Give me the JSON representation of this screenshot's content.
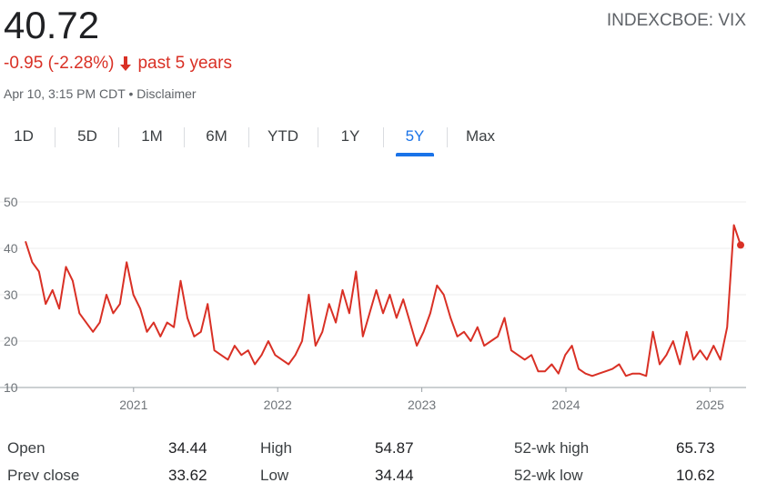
{
  "quote": {
    "price": "40.72",
    "ticker": "INDEXCBOE: VIX",
    "change": "-0.95 (-2.28%)",
    "period": "past 5 years",
    "meta": "Apr 10, 3:15 PM CDT • Disclaimer",
    "accent_color": "#d93025",
    "change_icon": "down-arrow-icon"
  },
  "tabs": [
    {
      "label": "1D"
    },
    {
      "label": "5D"
    },
    {
      "label": "1M"
    },
    {
      "label": "6M"
    },
    {
      "label": "YTD"
    },
    {
      "label": "1Y"
    },
    {
      "label": "5Y"
    },
    {
      "label": "Max"
    }
  ],
  "active_tab": "5Y",
  "chart_data": {
    "type": "line",
    "title": "",
    "xlabel": "",
    "ylabel": "",
    "ylim": [
      10,
      50
    ],
    "yticks": [
      "10",
      "20",
      "30",
      "40",
      "50"
    ],
    "xticks": [
      "2021",
      "2022",
      "2023",
      "2024",
      "2025"
    ],
    "grid": true,
    "line_color": "#d93025",
    "series": [
      {
        "x": [
          "2020-04",
          "2020-04",
          "2020-05",
          "2020-05",
          "2020-05",
          "2020-06",
          "2020-06",
          "2020-06",
          "2020-07",
          "2020-07",
          "2020-08",
          "2020-08",
          "2020-09",
          "2020-09",
          "2020-10",
          "2020-10",
          "2020-10",
          "2020-11",
          "2020-11",
          "2020-12",
          "2020-12",
          "2021-01",
          "2021-01",
          "2021-02",
          "2021-02",
          "2021-02",
          "2021-03",
          "2021-03",
          "2021-04",
          "2021-04",
          "2021-05",
          "2021-05",
          "2021-06",
          "2021-07",
          "2021-07",
          "2021-08",
          "2021-09",
          "2021-09",
          "2021-10",
          "2021-10",
          "2021-11",
          "2021-11",
          "2021-12",
          "2021-12",
          "2021-12",
          "2022-01",
          "2022-01",
          "2022-02",
          "2022-02",
          "2022-03",
          "2022-03",
          "2022-04",
          "2022-04",
          "2022-05",
          "2022-05",
          "2022-06",
          "2022-06",
          "2022-07",
          "2022-08",
          "2022-08",
          "2022-09",
          "2022-09",
          "2022-10",
          "2022-10",
          "2022-11",
          "2022-11",
          "2022-12",
          "2022-12",
          "2023-01",
          "2023-01",
          "2023-02",
          "2023-03",
          "2023-03",
          "2023-04",
          "2023-05",
          "2023-05",
          "2023-06",
          "2023-07",
          "2023-08",
          "2023-08",
          "2023-09",
          "2023-10",
          "2023-10",
          "2023-11",
          "2023-12",
          "2024-01",
          "2024-02",
          "2024-03",
          "2024-04",
          "2024-04",
          "2024-05",
          "2024-06",
          "2024-07",
          "2024-08",
          "2024-08",
          "2024-09",
          "2024-10",
          "2024-11",
          "2024-12",
          "2024-12",
          "2025-01",
          "2025-02",
          "2025-03",
          "2025-03",
          "2025-04",
          "2025-04",
          "2025-04"
        ],
        "values": [
          41.5,
          37,
          35,
          28,
          31,
          27,
          36,
          33,
          26,
          24,
          22,
          24,
          30,
          26,
          28,
          37,
          30,
          27,
          22,
          24,
          21,
          24,
          23,
          33,
          25,
          21,
          22,
          28,
          18,
          17,
          16,
          19,
          17,
          18,
          15,
          17,
          20,
          17,
          16,
          15,
          17,
          20,
          30,
          19,
          22,
          28,
          24,
          31,
          26,
          35,
          21,
          26,
          31,
          26,
          30,
          25,
          29,
          24,
          19,
          22,
          26,
          32,
          30,
          25,
          21,
          22,
          20,
          23,
          19,
          20,
          21,
          25,
          18,
          17,
          16,
          17,
          13.5,
          13.5,
          15,
          13,
          17,
          19,
          14,
          13,
          12.5,
          13,
          13.5,
          14,
          15,
          12.5,
          13,
          13,
          12.5,
          22,
          15,
          17,
          20,
          15,
          22,
          16,
          18,
          16,
          19,
          16,
          23,
          45,
          40.7
        ]
      }
    ]
  },
  "stats": {
    "col1": [
      {
        "label": "Open",
        "value": "34.44"
      },
      {
        "label": "Prev close",
        "value": "33.62"
      }
    ],
    "col2": [
      {
        "label": "High",
        "value": "54.87"
      },
      {
        "label": "Low",
        "value": "34.44"
      }
    ],
    "col3": [
      {
        "label": "52-wk high",
        "value": "65.73"
      },
      {
        "label": "52-wk low",
        "value": "10.62"
      }
    ]
  }
}
